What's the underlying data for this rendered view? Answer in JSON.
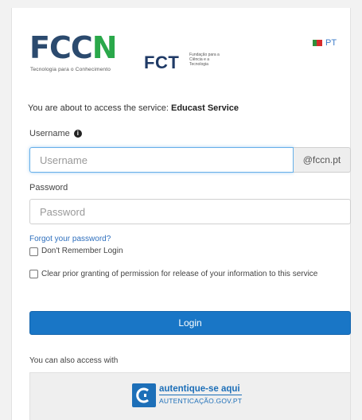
{
  "header": {
    "fccn_logo_prefix": "FCC",
    "fccn_logo_suffix": "N",
    "fccn_tagline": "Tecnologia para o Conhecimento",
    "fct_logo": "FCT",
    "fct_subtitle": "Fundação para a Ciência e a Tecnologia",
    "language_label": "PT"
  },
  "service": {
    "prefix": "You are about to access the service:",
    "name": "Educast Service"
  },
  "form": {
    "username_label": "Username",
    "username_placeholder": "Username",
    "username_value": "",
    "username_suffix": "@fccn.pt",
    "password_label": "Password",
    "password_placeholder": "Password",
    "password_value": "",
    "forgot_link": "Forgot your password?",
    "dont_remember_label": "Don't Remember Login",
    "clear_consent_label": "Clear prior granting of permission for release of your information to this service",
    "login_button": "Login"
  },
  "alternate": {
    "heading": "You can also access with",
    "gov_main": "autentique-se aqui",
    "gov_sub": "AUTENTICAÇÃO.GOV.PT"
  },
  "colors": {
    "primary_button": "#1976c6",
    "link": "#2e6fbd",
    "fccn_blue": "#2b4a6e",
    "fccn_green": "#2aa84a"
  },
  "icons": {
    "info": "info-circle-icon",
    "flag": "portugal-flag-icon",
    "gov": "autenticacao-gov-icon"
  }
}
